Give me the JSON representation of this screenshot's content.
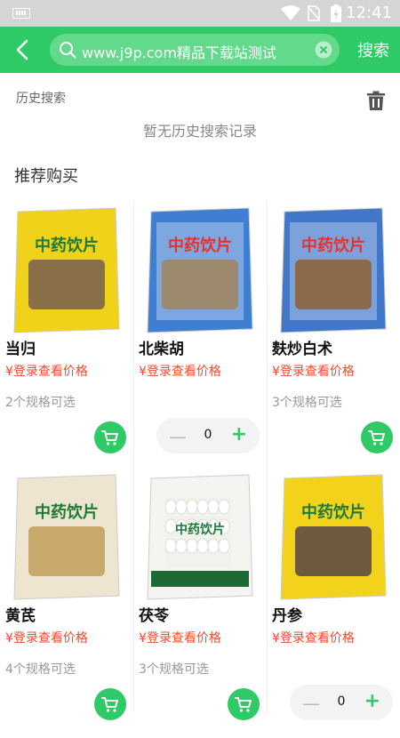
{
  "status_bar": {
    "time": "12:41"
  },
  "header": {
    "search_text": "www.j9p.com精品下载站测试",
    "search_button": "搜索"
  },
  "history": {
    "title": "历史搜索",
    "empty_text": "暂无历史搜索记录"
  },
  "recommend": {
    "title": "推荐购买",
    "products": [
      {
        "name": "当归",
        "price": "¥登录查看价格",
        "specs": "2个规格可选",
        "action": "cart"
      },
      {
        "name": "北柴胡",
        "price": "¥登录查看价格",
        "specs": "",
        "action": "stepper",
        "qty": "0"
      },
      {
        "name": "麸炒白术",
        "price": "¥登录查看价格",
        "specs": "3个规格可选",
        "action": "cart"
      },
      {
        "name": "黄芪",
        "price": "¥登录查看价格",
        "specs": "4个规格可选",
        "action": "cart"
      },
      {
        "name": "茯苓",
        "price": "¥登录查看价格",
        "specs": "3个规格可选",
        "action": "cart"
      },
      {
        "name": "丹参",
        "price": "¥登录查看价格",
        "specs": "",
        "action": "stepper",
        "qty": "0"
      }
    ],
    "package_label": "中药饮片"
  },
  "colors": {
    "brand": "#2eca66",
    "price": "#ef4b2e"
  }
}
